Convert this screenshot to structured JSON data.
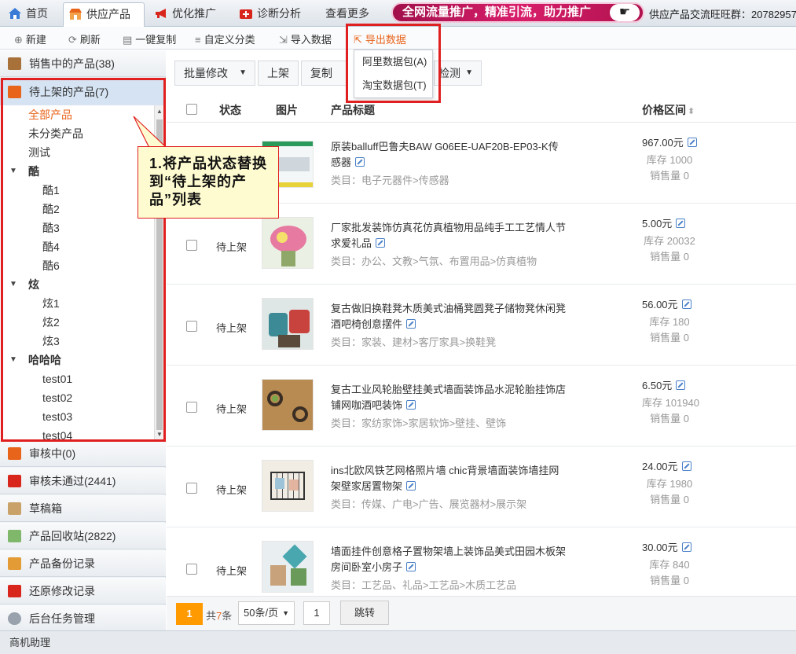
{
  "tabs": [
    {
      "label": "首页",
      "icon": "home-icon"
    },
    {
      "label": "供应产品",
      "icon": "shop-icon"
    },
    {
      "label": "优化推广",
      "icon": "megaphone-icon"
    },
    {
      "label": "诊断分析",
      "icon": "medical-kit-icon"
    },
    {
      "label": "查看更多"
    }
  ],
  "promo": {
    "text": "全网流量推广，精准引流，助力推广",
    "icon": "pointing-hand-icon"
  },
  "group_text": "供应产品交流旺旺群：20782957",
  "toolbar": {
    "new": "新建",
    "refresh": "刷新",
    "copy": "一键复制",
    "custom_category": "自定义分类",
    "import": "导入数据",
    "export": "导出数据"
  },
  "export_menu": [
    "阿里数据包(A)",
    "淘宝数据包(T)"
  ],
  "sidebar": {
    "on_sale": "销售中的产品(38)",
    "pending": "待上架的产品(7)",
    "reviewing": "审核中(0)",
    "rejected": "审核未通过(2441)",
    "drafts": "草稿箱",
    "recycle": "产品回收站(2822)",
    "backup": "产品备份记录",
    "restore": "还原修改记录",
    "tasks": "后台任务管理"
  },
  "tree": {
    "all": "全部产品",
    "uncategorized": "未分类产品",
    "test": "测试",
    "groups": [
      {
        "name": "酷",
        "children": [
          "酷1",
          "酷2",
          "酷3",
          "酷4",
          "酷6"
        ]
      },
      {
        "name": "炫",
        "children": [
          "炫1",
          "炫2",
          "炫3"
        ]
      },
      {
        "name": "哈哈哈",
        "children": [
          "test01",
          "test02",
          "test03",
          "test04"
        ]
      }
    ]
  },
  "callout": "1.将产品状态替换到“待上架的产品”列表",
  "actions": {
    "batch": "批量修改",
    "shelf": "上架",
    "copy": "复制",
    "detect": "检测"
  },
  "table": {
    "headers": {
      "status": "状态",
      "image": "图片",
      "title": "产品标题",
      "price": "价格区间"
    },
    "rows": [
      {
        "status": "",
        "title": "原装balluff巴鲁夫BAW G06EE-UAF20B-EP03-K传感器",
        "category": "类目：电子元器件>传感器",
        "price": "967.00元",
        "stock": "库存 1000",
        "sales": "销售量 0"
      },
      {
        "status": "待上架",
        "title": "厂家批发装饰仿真花仿真植物用品纯手工工艺情人节求爱礼品",
        "category": "类目：办公、文教>气氛、布置用品>仿真植物",
        "price": "5.00元",
        "stock": "库存 20032",
        "sales": "销售量 0"
      },
      {
        "status": "待上架",
        "title": "复古做旧换鞋凳木质美式油桶凳圆凳子储物凳休闲凳酒吧椅创意摆件",
        "category": "类目：家装、建材>客厅家具>换鞋凳",
        "price": "56.00元",
        "stock": "库存 180",
        "sales": "销售量 0"
      },
      {
        "status": "待上架",
        "title": "复古工业风轮胎壁挂美式墙面装饰品水泥轮胎挂饰店铺网咖酒吧装饰",
        "category": "类目：家纺家饰>家居软饰>壁挂、壁饰",
        "price": "6.50元",
        "stock": "库存 101940",
        "sales": "销售量 0"
      },
      {
        "status": "待上架",
        "title": "ins北欧风铁艺网格照片墙 chic背景墙面装饰墙挂网架壁家居置物架",
        "category": "类目：传媒、广电>广告、展览器材>展示架",
        "price": "24.00元",
        "stock": "库存 1980",
        "sales": "销售量 0"
      },
      {
        "status": "待上架",
        "title": "墙面挂件创意格子置物架墙上装饰品美式田园木板架房间卧室小房子",
        "category": "类目：工艺品、礼品>工艺品>木质工艺品",
        "price": "30.00元",
        "stock": "库存 840",
        "sales": "销售量 0"
      }
    ]
  },
  "pager": {
    "current": "1",
    "total_prefix": "共",
    "total_num": "7",
    "total_suffix": "条",
    "per_page": "50条/页",
    "page_input": "1",
    "go": "跳转"
  },
  "statusbar": "商机助理"
}
